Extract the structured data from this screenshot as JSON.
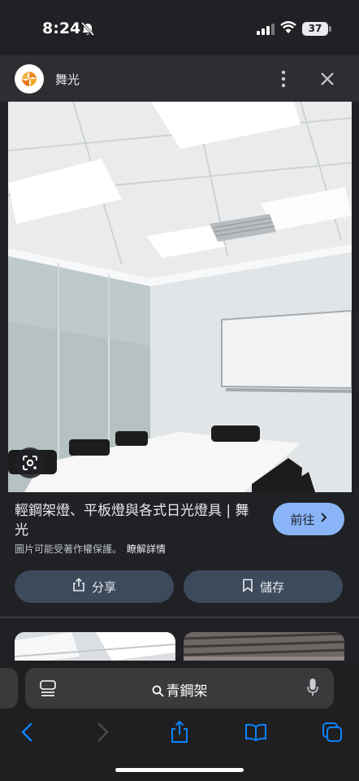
{
  "status_bar": {
    "time": "8:24",
    "battery_level": "37"
  },
  "site": {
    "name": "舞光",
    "logo_icon": "wuguang-logo",
    "brand_color": "#f08a1f"
  },
  "result": {
    "title": "輕鋼架燈、平板燈與各式日光燈具 | 舞光",
    "visit_label": "前往",
    "copyright_notice": "圖片可能受著作權保護。",
    "learn_more_label": "瞭解詳情"
  },
  "actions": {
    "share_label": "分享",
    "save_label": "儲存"
  },
  "browser": {
    "address_text": "青鋼架"
  },
  "colors": {
    "accent": "#8ab4f8",
    "action_button_bg": "#3c4a5c",
    "safari_blue": "#0a84ff",
    "background": "#202124"
  }
}
